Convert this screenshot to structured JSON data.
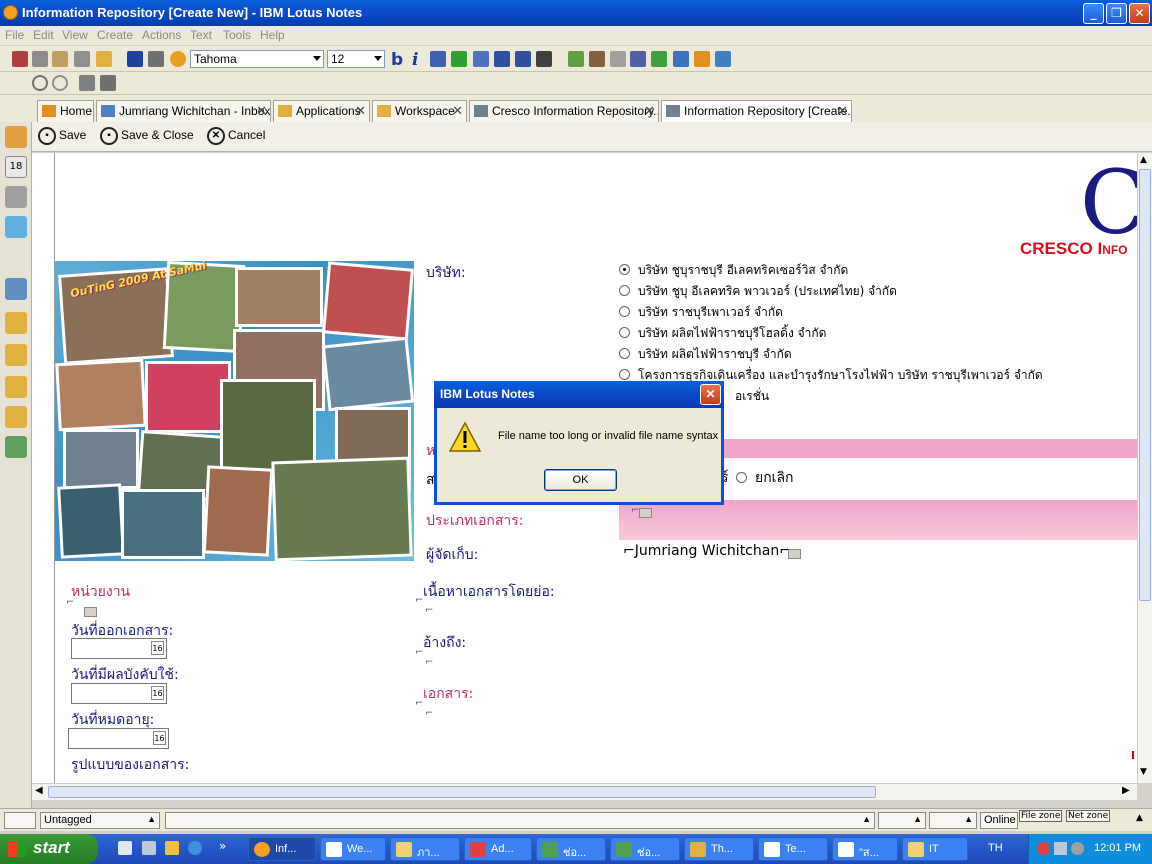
{
  "window": {
    "title": "Information Repository [Create New] - IBM Lotus Notes",
    "minimize": "_",
    "restore": "❐",
    "close": "✕"
  },
  "menu": [
    "File",
    "Edit",
    "View",
    "Create",
    "Actions",
    "Text",
    "Tools",
    "Help"
  ],
  "toolbar": {
    "font_name": "Tahoma",
    "font_size": "12",
    "bold": "b",
    "italic": "i"
  },
  "tabs": [
    {
      "label": "Home"
    },
    {
      "label": "Jumriang Wichitchan - Inbox"
    },
    {
      "label": "Applications"
    },
    {
      "label": "Workspace"
    },
    {
      "label": "Cresco Information Repository..."
    },
    {
      "label": "Information Repository [Create..."
    }
  ],
  "actions": {
    "save": "Save",
    "save_close": "Save & Close",
    "cancel": "Cancel"
  },
  "form": {
    "logo_letter": "C",
    "logo_text": "CRESCO I",
    "logo_text_small": "NFO",
    "photo_caption": "OuTinG 2009 At SaMui",
    "company_label": "บริษัท:",
    "companies": [
      "บริษัท ชูบุราชบุรี อีเลคทริคเซอร์วิส จำกัด",
      "บริษัท ชูบุ อีเลคทริค พาวเวอร์ (ประเทศไทย) จำกัด",
      "บริษัท ราชบุรีเพาเวอร์ จำกัด",
      "บริษัท ผลิตไฟฟ้าราชบุรีโฮลดิ้ง จำกัด",
      "บริษัท ผลิตไฟฟ้าราชบุรี จำกัด",
      "โครงการธุรกิจเดินเครื่อง และบำรุงรักษาโรงไฟฟ้า บริษัท ราชบุรีเพาเวอร์ จำกัด",
      "อเรชั่น"
    ],
    "status_partial": "ส",
    "status_opt1_tail": "ร์",
    "status_cancel": "ยกเลิก",
    "partial_label": "ห",
    "doc_type_label": "ประเภทเอกสาร:",
    "keeper_label": "ผู้จัดเก็บ:",
    "keeper_value": "Jumriang Wichitchan",
    "unit_label": "หน่วยงาน",
    "summary_label": "เนื้อหาเอกสารโดยย่อ:",
    "issue_date_label": "วันที่ออกเอกสาร:",
    "effective_date_label": "วันที่มีผลบังคับใช้:",
    "expiry_date_label": "วันที่หมดอายุ:",
    "reference_label": "อ้างถึง:",
    "document_label": "เอกสาร:",
    "format_label": "รูปแบบของเอกสาร:",
    "cal_day": "16"
  },
  "dialog": {
    "title": "IBM Lotus Notes",
    "message": "File name too long or invalid file name syntax",
    "ok": "OK",
    "close": "✕"
  },
  "status": {
    "category": "Untagged",
    "online": "Online",
    "file_zone": "File zone",
    "net_zone": "Net zone"
  },
  "taskbar": {
    "start": "start",
    "tasks": [
      "Inf...",
      "We...",
      "ภา...",
      "Ad...",
      "ช่อ...",
      "ช่อ...",
      "Th...",
      "Te...",
      "\"ส...",
      "IT"
    ],
    "lang": "TH",
    "clock": "12:01 PM"
  },
  "colors": {
    "accent_blue": "#0b46c4",
    "pink_label": "#c8286e",
    "logo_red": "#d8101c",
    "logo_navy": "#1a1a80",
    "pink_band": "#f0a6c8"
  }
}
